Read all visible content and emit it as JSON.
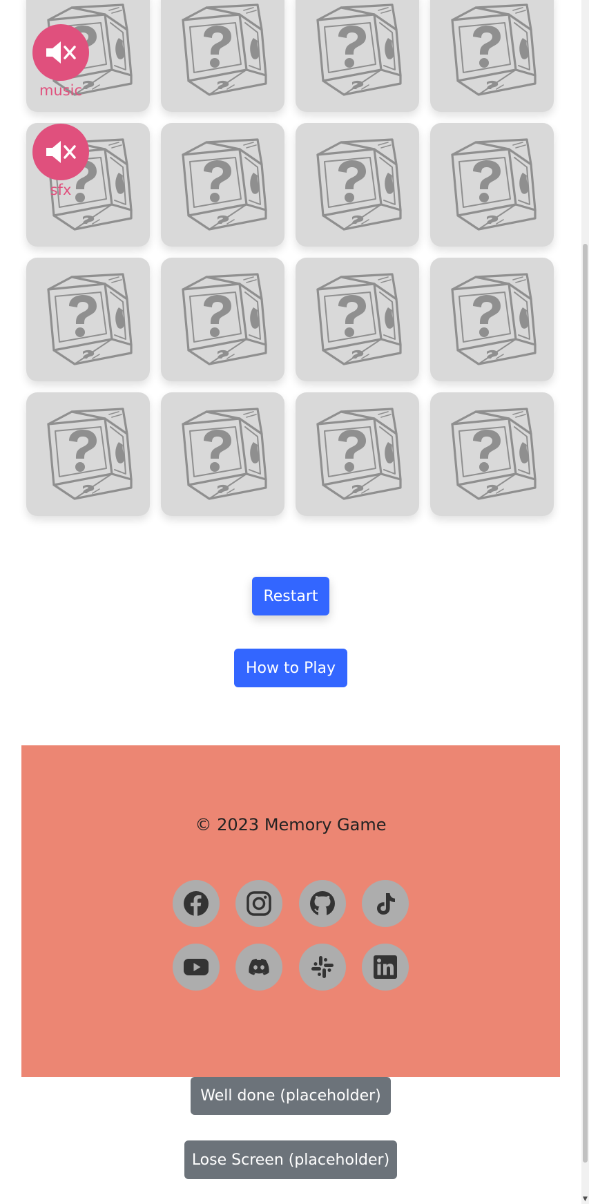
{
  "sound_controls": {
    "music": {
      "label": "music",
      "icon": "speaker-muted-icon",
      "state": "muted"
    },
    "sfx": {
      "label": "sfx",
      "icon": "speaker-muted-icon",
      "state": "muted"
    }
  },
  "board": {
    "card_count": 16,
    "card_face": "mystery-question-block",
    "card_icon": "question-block-icon"
  },
  "buttons": {
    "restart": "Restart",
    "how_to_play": "How to Play",
    "well_done": "Well done (placeholder)",
    "lose_screen": "Lose Screen (placeholder)"
  },
  "footer": {
    "copyright": "© 2023 Memory Game",
    "social_links": [
      {
        "name": "facebook",
        "icon": "facebook-icon"
      },
      {
        "name": "instagram",
        "icon": "instagram-icon"
      },
      {
        "name": "github",
        "icon": "github-icon"
      },
      {
        "name": "tiktok",
        "icon": "tiktok-icon"
      },
      {
        "name": "youtube",
        "icon": "youtube-icon"
      },
      {
        "name": "discord",
        "icon": "discord-icon"
      },
      {
        "name": "slack",
        "icon": "slack-icon"
      },
      {
        "name": "linkedin",
        "icon": "linkedin-icon"
      }
    ]
  },
  "colors": {
    "card_background": "#d9d9d9",
    "card_sketch": "#8f8f8f",
    "toggle_accent": "#e0507d",
    "primary_button": "#3366ff",
    "secondary_button": "#6c737a",
    "footer_background": "#ec8673",
    "social_circle": "#adadad",
    "social_glyph": "#333333"
  }
}
